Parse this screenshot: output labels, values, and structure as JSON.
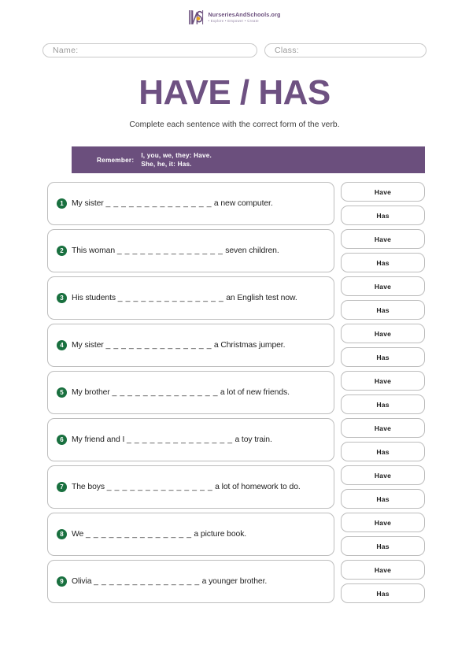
{
  "header": {
    "logo_icon": "ns-monogram-icon",
    "logo_title": "NurseriesAndSchools.org",
    "logo_tagline": "• Explore  • Empower  • Create",
    "brand_purple": "#6b4f7d",
    "brand_accent": "#e8a317"
  },
  "id_row": {
    "name_label": "Name:",
    "class_label": "Class:",
    "name_value": "",
    "class_value": "",
    "name_placeholder": "",
    "class_placeholder": ""
  },
  "title": "HAVE / HAS",
  "subtitle": "Complete each sentence with the correct form of the verb.",
  "banner": {
    "label": "Remember:",
    "line1": "I, you, we, they: Have.",
    "line2": "She, he, it: Has.",
    "background": "#6b4f7d",
    "text_color": "#ffffff"
  },
  "options": {
    "have": "Have",
    "has": "Has"
  },
  "badge_color": "#19703f",
  "questions": [
    {
      "number": "1",
      "pre": "My sister ",
      "blank": "_ _ _ _ _ _ _ _ _ _ _ _ _ _",
      "post": " a new computer."
    },
    {
      "number": "2",
      "pre": "This woman ",
      "blank": "_ _ _ _ _ _ _ _ _ _ _ _ _ _",
      "post": " seven children."
    },
    {
      "number": "3",
      "pre": "His students ",
      "blank": "_ _ _ _ _ _ _ _ _ _ _ _ _ _",
      "post": " an English test now."
    },
    {
      "number": "4",
      "pre": "My sister ",
      "blank": "_ _ _ _ _ _ _ _ _ _ _ _ _ _",
      "post": " a Christmas jumper."
    },
    {
      "number": "5",
      "pre": "My brother ",
      "blank": "_ _ _ _ _ _ _ _ _ _ _ _ _ _",
      "post": " a lot of new friends."
    },
    {
      "number": "6",
      "pre": "My friend and I ",
      "blank": "_ _ _ _ _ _ _ _ _ _ _ _ _ _",
      "post": " a toy train."
    },
    {
      "number": "7",
      "pre": "The boys ",
      "blank": "_ _ _ _ _ _ _ _ _ _ _ _ _ _",
      "post": " a lot of homework to do."
    },
    {
      "number": "8",
      "pre": "We ",
      "blank": "_ _ _ _ _ _ _ _ _ _ _ _ _ _",
      "post": " a picture book."
    },
    {
      "number": "9",
      "pre": "Olivia ",
      "blank": "_ _ _ _ _ _ _ _ _ _ _ _ _ _",
      "post": " a younger brother."
    }
  ]
}
